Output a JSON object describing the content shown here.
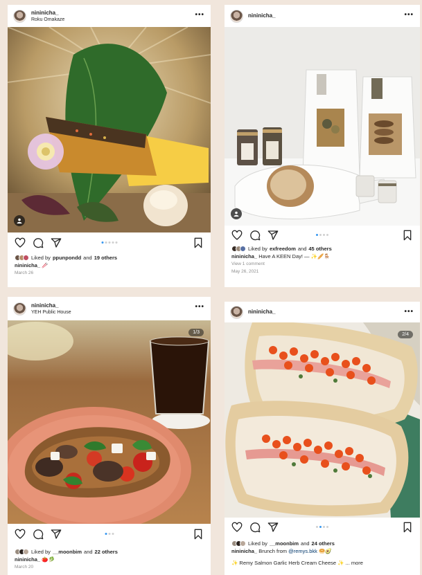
{
  "posts": [
    {
      "username": "nininicha_",
      "location": "Roku Omakaze",
      "liked_by_prefix": "Liked by",
      "liked_by_user": "ppunpondd",
      "liked_and": "and",
      "liked_others": "19 others",
      "caption_user": "nininicha_",
      "caption_text": "🥢",
      "date": "March 26"
    },
    {
      "username": "nininicha_",
      "liked_by_prefix": "Liked by",
      "liked_by_user": "exfreedom",
      "liked_and": "and",
      "liked_others": "45 others",
      "caption_user": "nininicha_",
      "caption_text": "Have A KEEN Day! — ✨🥖🪑",
      "comments": "View 1 comment",
      "date": "May 26, 2021"
    },
    {
      "username": "nininicha_",
      "location": "YEH Public House",
      "counter": "1/3",
      "liked_by_prefix": "Liked by",
      "liked_by_user": "__moonbim",
      "liked_and": "and",
      "liked_others": "22 others",
      "caption_user": "nininicha_",
      "caption_text": "🍅🥬",
      "date": "March 20"
    },
    {
      "username": "nininicha_",
      "counter": "2/4",
      "liked_by_prefix": "Liked by",
      "liked_by_user": "__moonbim",
      "liked_and": "and",
      "liked_others": "24 others",
      "caption_user": "nininicha_",
      "caption_text": "Brunch from",
      "caption_mention": "@remys.bkk",
      "caption_emoji": "🥯🥑",
      "caption_line2": "✨ Remy Salmon Garlic Herb Cream Cheese ✨ ... more"
    }
  ],
  "colors": {
    "background": "#f1e6dc",
    "accent_dot": "#3897f0",
    "text": "#262626",
    "muted": "#8e8e8e"
  },
  "icons": [
    "heart-icon",
    "comment-icon",
    "share-icon",
    "bookmark-icon",
    "more-icon",
    "user-tag-icon"
  ]
}
